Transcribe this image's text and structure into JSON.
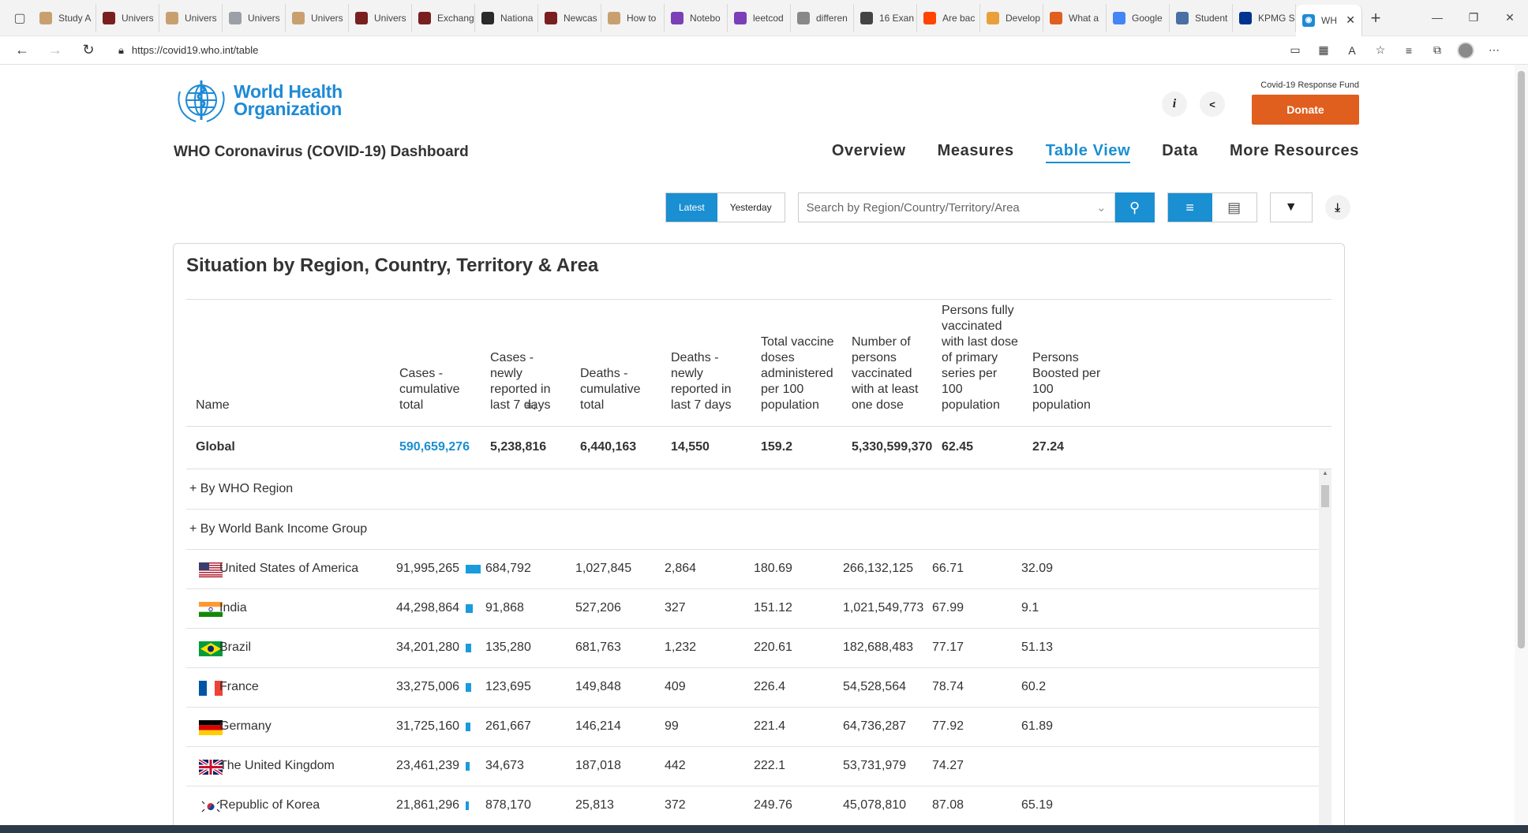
{
  "browser": {
    "tabs": [
      {
        "label": "Study A",
        "color": "#c8a070"
      },
      {
        "label": "Univers",
        "color": "#7a1f1f"
      },
      {
        "label": "Univers",
        "color": "#c8a070"
      },
      {
        "label": "Univers",
        "color": "#9aa0a6"
      },
      {
        "label": "Univers",
        "color": "#c8a070"
      },
      {
        "label": "Univers",
        "color": "#7a1f1f"
      },
      {
        "label": "Exchang",
        "color": "#7a1f1f"
      },
      {
        "label": "Nationa",
        "color": "#2a2a2a"
      },
      {
        "label": "Newcas",
        "color": "#7a1f1f"
      },
      {
        "label": "How to",
        "color": "#c8a070"
      },
      {
        "label": "Notebo",
        "color": "#7b3fb8"
      },
      {
        "label": "leetcod",
        "color": "#7b3fb8"
      },
      {
        "label": "differen",
        "color": "#888888"
      },
      {
        "label": "16 Exan",
        "color": "#444444"
      },
      {
        "label": "Are bac",
        "color": "#ff4500"
      },
      {
        "label": "Develop",
        "color": "#e9a03b"
      },
      {
        "label": "What a",
        "color": "#e05e1e"
      },
      {
        "label": "Google",
        "color": "#4285f4"
      },
      {
        "label": "Student",
        "color": "#4a6fa5"
      },
      {
        "label": "KPMG S",
        "color": "#00338d"
      }
    ],
    "active_tab": {
      "label": "WH",
      "color": "#1e8ad6"
    },
    "url": "https://covid19.who.int/table"
  },
  "header": {
    "logo_line1": "World Health",
    "logo_line2": "Organization",
    "title": "WHO Coronavirus (COVID-19) Dashboard",
    "fund_label": "Covid-19 Response Fund",
    "donate_label": "Donate",
    "nav": [
      "Overview",
      "Measures",
      "Table View",
      "Data",
      "More Resources"
    ],
    "active_nav": "Table View"
  },
  "toolbar": {
    "latest_label": "Latest",
    "yesterday_label": "Yesterday",
    "search_placeholder": "Search by Region/Country/Territory/Area"
  },
  "table": {
    "title": "Situation by Region, Country, Territory & Area",
    "columns": [
      "Name",
      "Cases - cumulative total",
      "Cases - newly reported in last 7 days",
      "Deaths - cumulative total",
      "Deaths - newly reported in last 7 days",
      "Total vaccine doses administered per 100 population",
      "Number of persons vaccinated with at least one dose",
      "Persons fully vaccinated with last dose of primary series per 100 population",
      "Persons Boosted per 100 population"
    ],
    "global": [
      "Global",
      "590,659,276",
      "5,238,816",
      "6,440,163",
      "14,550",
      "159.2",
      "5,330,599,370",
      "62.45",
      "27.24"
    ],
    "groups": [
      "+ By WHO Region",
      "+ By World Bank Income Group"
    ],
    "rows": [
      {
        "flag": "us",
        "name": "United States of America",
        "cases": "91,995,265",
        "bar": 0.156,
        "new_cases": "684,792",
        "deaths": "1,027,845",
        "new_deaths": "2,864",
        "doses": "180.69",
        "one_dose": "266,132,125",
        "full": "66.71",
        "boosted": "32.09"
      },
      {
        "flag": "in",
        "name": "India",
        "cases": "44,298,864",
        "bar": 0.075,
        "new_cases": "91,868",
        "deaths": "527,206",
        "new_deaths": "327",
        "doses": "151.12",
        "one_dose": "1,021,549,773",
        "full": "67.99",
        "boosted": "9.1"
      },
      {
        "flag": "br",
        "name": "Brazil",
        "cases": "34,201,280",
        "bar": 0.058,
        "new_cases": "135,280",
        "deaths": "681,763",
        "new_deaths": "1,232",
        "doses": "220.61",
        "one_dose": "182,688,483",
        "full": "77.17",
        "boosted": "51.13"
      },
      {
        "flag": "fr",
        "name": "France",
        "cases": "33,275,006",
        "bar": 0.056,
        "new_cases": "123,695",
        "deaths": "149,848",
        "new_deaths": "409",
        "doses": "226.4",
        "one_dose": "54,528,564",
        "full": "78.74",
        "boosted": "60.2"
      },
      {
        "flag": "de",
        "name": "Germany",
        "cases": "31,725,160",
        "bar": 0.054,
        "new_cases": "261,667",
        "deaths": "146,214",
        "new_deaths": "99",
        "doses": "221.4",
        "one_dose": "64,736,287",
        "full": "77.92",
        "boosted": "61.89"
      },
      {
        "flag": "gb",
        "name": "The United Kingdom",
        "cases": "23,461,239",
        "bar": 0.04,
        "new_cases": "34,673",
        "deaths": "187,018",
        "new_deaths": "442",
        "doses": "222.1",
        "one_dose": "53,731,979",
        "full": "74.27",
        "boosted": ""
      },
      {
        "flag": "kr",
        "name": "Republic of Korea",
        "cases": "21,861,296",
        "bar": 0.037,
        "new_cases": "878,170",
        "deaths": "25,813",
        "new_deaths": "372",
        "doses": "249.76",
        "one_dose": "45,078,810",
        "full": "87.08",
        "boosted": "65.19"
      }
    ]
  }
}
